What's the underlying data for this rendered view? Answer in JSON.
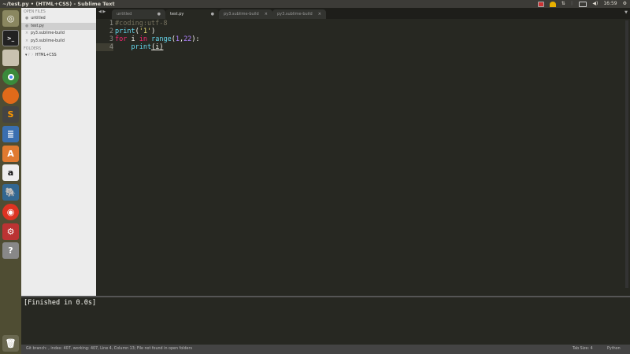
{
  "window": {
    "title": "~/test.py • (HTML+CSS) - Sublime Text"
  },
  "tray": {
    "clock": "16:59"
  },
  "launcher": [
    "ubuntu-dash",
    "terminal",
    "files",
    "chrome",
    "firefox",
    "sublime-text",
    "libreoffice-writer",
    "software-center",
    "amazon",
    "postgresql",
    "netease-music",
    "system-settings",
    "help"
  ],
  "sidebar": {
    "open_files_header": "OPEN FILES",
    "open_files": [
      "untitled",
      "test.py",
      "py3.sublime-build",
      "py3.sublime-build"
    ],
    "folders_header": "FOLDERS",
    "folders": [
      "HTML+CSS"
    ]
  },
  "tabs": [
    {
      "label": "untitled",
      "close": "●"
    },
    {
      "label": "test.py",
      "close": "●"
    },
    {
      "label": "py3.sublime-build",
      "close": "×"
    },
    {
      "label": "py3.sublime-build",
      "close": "×"
    }
  ],
  "editor": {
    "lines": [
      "1",
      "2",
      "3",
      "4"
    ],
    "code": {
      "l1": "#coding:utf-8",
      "l2a": "print",
      "l2b": "(",
      "l2c": "'1'",
      "l2d": ")",
      "l3a": "for",
      "l3b": " i ",
      "l3c": "in",
      "l3d": " ",
      "l3e": "range",
      "l3f": "(",
      "l3g": "1",
      "l3h": ",",
      "l3i": "22",
      "l3j": "):",
      "l4a": "    ",
      "l4b": "print",
      "l4c": "(i)"
    }
  },
  "panel": {
    "output": "[Finished in 0.0s]"
  },
  "status": {
    "left": "Git branch: , index: 407, working: 407, Line 4, Column 13; File not found in open folders",
    "tab_size": "Tab Size: 4",
    "syntax": "Python"
  }
}
